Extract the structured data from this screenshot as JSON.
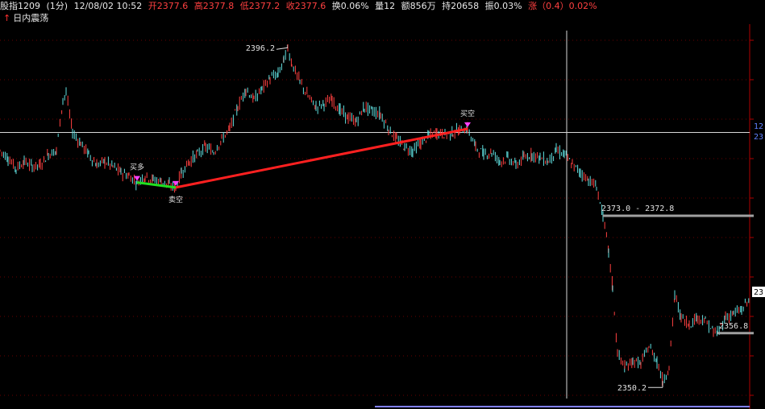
{
  "header": {
    "name": "股指1209",
    "period": "(1分)",
    "datetime": "12/08/02 10:52",
    "open": "开2377.6",
    "high": "高2377.8",
    "low": "低2377.2",
    "close": "收2377.6",
    "turnover": "换0.06%",
    "volume": "量12",
    "amount": "额856万",
    "position": "持20658",
    "amplitude": "振0.03%",
    "change": "涨（0.4）0.02%"
  },
  "indicator_title": "日内震荡",
  "colors": {
    "background": "#000000",
    "up_candle": "#ff4040",
    "down_candle": "#60e0e0",
    "axis": "#b00000",
    "grid": "#b00000",
    "red_line": "#ff2020",
    "green_line": "#20e020",
    "marker": "#ff40ff",
    "text_value": "#ff4040",
    "text_label": "#e0e0e0"
  },
  "chart_data": {
    "type": "candlestick",
    "y_range": [
      2347,
      2399
    ],
    "x_range": [
      0,
      930
    ],
    "price_series": [
      [
        0,
        2382.0
      ],
      [
        10,
        2381.0
      ],
      [
        20,
        2379.5
      ],
      [
        30,
        2380.5
      ],
      [
        40,
        2379.8
      ],
      [
        50,
        2380.0
      ],
      [
        60,
        2381.5
      ],
      [
        70,
        2382.0
      ],
      [
        78,
        2389.0
      ],
      [
        82,
        2390.0
      ],
      [
        90,
        2384.5
      ],
      [
        100,
        2383.0
      ],
      [
        110,
        2381.5
      ],
      [
        120,
        2380.0
      ],
      [
        130,
        2380.5
      ],
      [
        140,
        2379.8
      ],
      [
        150,
        2379.0
      ],
      [
        160,
        2378.5
      ],
      [
        170,
        2377.6
      ],
      [
        180,
        2378.5
      ],
      [
        190,
        2378.0
      ],
      [
        200,
        2377.8
      ],
      [
        210,
        2377.2
      ],
      [
        218,
        2376.9
      ],
      [
        225,
        2379.0
      ],
      [
        235,
        2380.5
      ],
      [
        245,
        2381.5
      ],
      [
        255,
        2382.5
      ],
      [
        265,
        2381.8
      ],
      [
        275,
        2383.5
      ],
      [
        285,
        2385.0
      ],
      [
        295,
        2388.0
      ],
      [
        305,
        2390.5
      ],
      [
        315,
        2389.0
      ],
      [
        325,
        2390.5
      ],
      [
        335,
        2392.0
      ],
      [
        345,
        2392.5
      ],
      [
        352,
        2394.5
      ],
      [
        357,
        2396.2
      ],
      [
        362,
        2394.0
      ],
      [
        372,
        2391.5
      ],
      [
        382,
        2389.5
      ],
      [
        392,
        2388.0
      ],
      [
        402,
        2388.5
      ],
      [
        412,
        2389.0
      ],
      [
        422,
        2387.5
      ],
      [
        432,
        2386.5
      ],
      [
        442,
        2386.0
      ],
      [
        452,
        2388.0
      ],
      [
        462,
        2387.5
      ],
      [
        472,
        2387.0
      ],
      [
        482,
        2385.0
      ],
      [
        492,
        2383.5
      ],
      [
        502,
        2382.5
      ],
      [
        512,
        2382.0
      ],
      [
        522,
        2383.0
      ],
      [
        532,
        2384.0
      ],
      [
        542,
        2384.5
      ],
      [
        552,
        2384.2
      ],
      [
        562,
        2384.5
      ],
      [
        570,
        2384.8
      ],
      [
        580,
        2385.0
      ],
      [
        590,
        2382.5
      ],
      [
        600,
        2381.5
      ],
      [
        610,
        2381.8
      ],
      [
        620,
        2380.5
      ],
      [
        630,
        2381.0
      ],
      [
        640,
        2380.0
      ],
      [
        650,
        2381.0
      ],
      [
        660,
        2381.5
      ],
      [
        670,
        2381.0
      ],
      [
        680,
        2380.5
      ],
      [
        690,
        2382.0
      ],
      [
        700,
        2381.5
      ],
      [
        710,
        2380.0
      ],
      [
        720,
        2379.0
      ],
      [
        730,
        2378.0
      ],
      [
        740,
        2377.0
      ],
      [
        748,
        2373.0
      ],
      [
        755,
        2368.0
      ],
      [
        760,
        2363.0
      ],
      [
        766,
        2354.0
      ],
      [
        775,
        2352.0
      ],
      [
        785,
        2353.0
      ],
      [
        795,
        2352.5
      ],
      [
        805,
        2355.0
      ],
      [
        815,
        2353.0
      ],
      [
        822,
        2350.2
      ],
      [
        830,
        2352.0
      ],
      [
        837,
        2362.0
      ],
      [
        845,
        2359.0
      ],
      [
        855,
        2358.0
      ],
      [
        865,
        2359.0
      ],
      [
        875,
        2358.5
      ],
      [
        885,
        2357.0
      ],
      [
        890,
        2356.8
      ],
      [
        900,
        2359.0
      ],
      [
        910,
        2359.5
      ],
      [
        920,
        2360.0
      ],
      [
        930,
        2361.5
      ]
    ],
    "annotations": [
      {
        "label": "2396.2",
        "x": 357,
        "y": 2396.2
      },
      {
        "label": "2350.2",
        "x": 822,
        "y": 2350.2
      },
      {
        "label": "2373.0 - 2372.8",
        "x": 748,
        "y": 2373.0
      },
      {
        "label": "2356.8",
        "x": 890,
        "y": 2356.8
      }
    ],
    "trend_lines": [
      {
        "color": "red",
        "from": [
          218,
          2376.9
        ],
        "to": [
          580,
          2385.0
        ]
      },
      {
        "color": "green",
        "from": [
          170,
          2377.6
        ],
        "to": [
          218,
          2376.9
        ]
      }
    ],
    "level_lines": [
      {
        "from_x": 748,
        "to_x": 935,
        "y": 2373.0
      },
      {
        "from_x": 890,
        "to_x": 935,
        "y": 2356.8
      }
    ],
    "horizontal_reference": 2384.5,
    "vertical_reference_x": 703,
    "signals": [
      {
        "x": 170,
        "y": 2377.6,
        "label": "买多"
      },
      {
        "x": 218,
        "y": 2376.9,
        "label": "卖空"
      },
      {
        "x": 580,
        "y": 2385.0,
        "label": "买空"
      }
    ],
    "right_axis_labels": [
      "12",
      "23",
      "23"
    ]
  }
}
